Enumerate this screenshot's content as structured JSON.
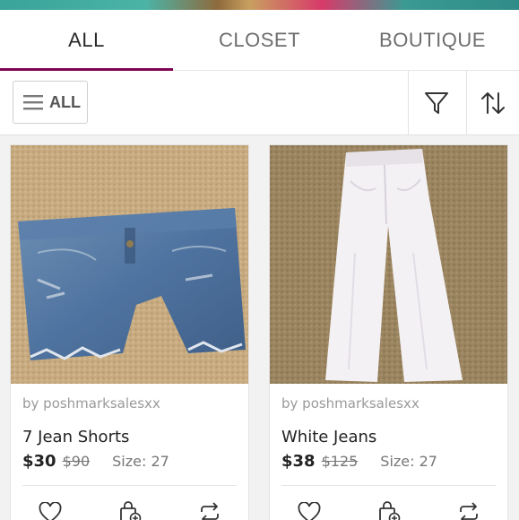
{
  "tabs": [
    {
      "label": "ALL",
      "active": true
    },
    {
      "label": "CLOSET",
      "active": false
    },
    {
      "label": "BOUTIQUE",
      "active": false
    }
  ],
  "toolbar": {
    "filter_label": "ALL",
    "filter_icon": "hamburger-icon",
    "funnel_icon": "funnel-icon",
    "sort_icon": "sort-arrows-icon"
  },
  "listings": [
    {
      "seller": "by poshmarksalesxx",
      "title": "7 Jean Shorts",
      "price": "$30",
      "original_price": "$90",
      "size": "Size: 27",
      "image": "denim-shorts-photo"
    },
    {
      "seller": "by poshmarksalesxx",
      "title": "White Jeans",
      "price": "$38",
      "original_price": "$125",
      "size": "Size: 27",
      "image": "white-jeans-photo"
    }
  ],
  "colors": {
    "accent": "#7f0353",
    "background": "#f3f2f2",
    "card": "#ffffff"
  }
}
